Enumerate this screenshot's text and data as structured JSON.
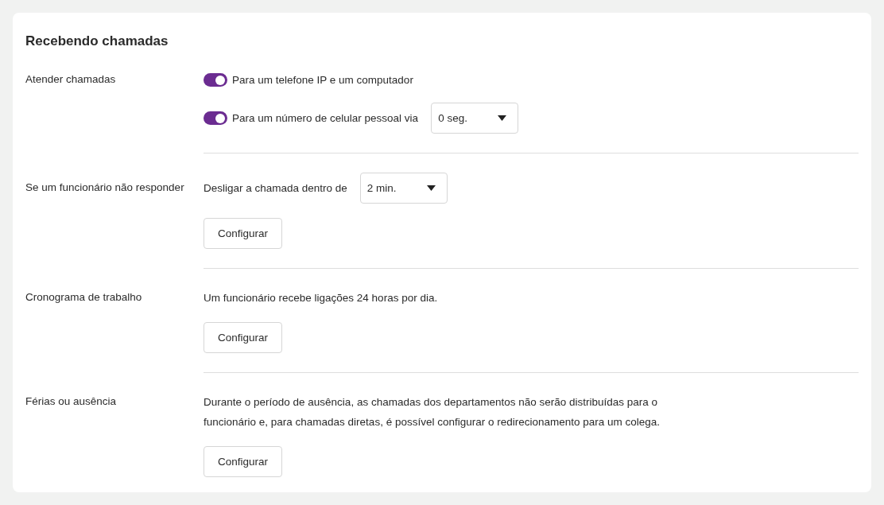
{
  "title": "Recebendo chamadas",
  "sections": [
    {
      "label": "Atender chamadas",
      "items": [
        {
          "kind": "toggle",
          "label": "Para um telefone IP e um computador",
          "on": true
        },
        {
          "kind": "toggle",
          "label": "Para um número de celular pessoal via",
          "on": true,
          "select": "0 seg."
        }
      ]
    },
    {
      "label": "Se um funcionário não responder",
      "items": [
        {
          "kind": "text",
          "text": "Desligar a chamada dentro de",
          "select": "2 min."
        },
        {
          "kind": "button",
          "label": "Configurar"
        }
      ]
    },
    {
      "label": "Cronograma de trabalho",
      "items": [
        {
          "kind": "text",
          "text": "Um funcionário recebe ligações 24 horas por dia."
        },
        {
          "kind": "button",
          "label": "Configurar"
        }
      ]
    },
    {
      "label": "Férias ou ausência",
      "items": [
        {
          "kind": "text",
          "text": "Durante o período de ausência, as chamadas dos departamentos não serão distribuídas para o funcionário e, para chamadas diretas, é possível configurar o redirecionamento para um colega."
        },
        {
          "kind": "button",
          "label": "Configurar"
        }
      ]
    }
  ]
}
